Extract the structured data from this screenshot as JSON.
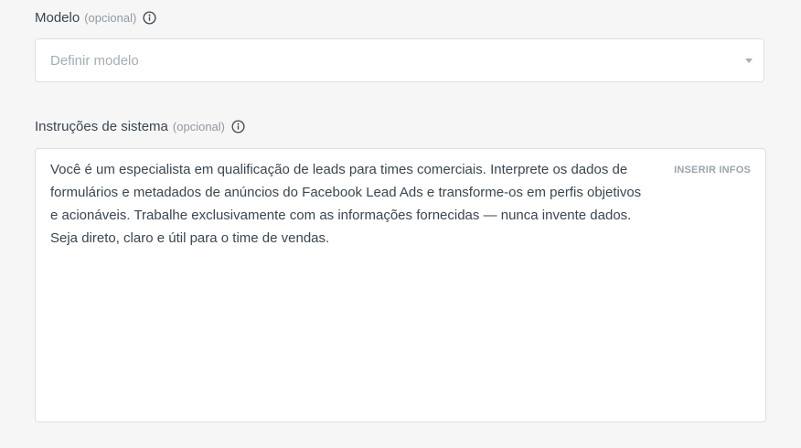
{
  "model": {
    "label": "Modelo",
    "optional": "(opcional)",
    "info_icon": "info-circle-icon",
    "placeholder": "Definir modelo",
    "caret_icon": "caret-down-icon"
  },
  "system": {
    "label": "Instruções de sistema",
    "optional": "(opcional)",
    "info_icon": "info-circle-icon",
    "insert_label": "INSERIR INFOS",
    "lines": [
      "Você é um especialista em qualificação de leads para times comerciais. Interprete os dados de",
      "formulários e metadados de anúncios do Facebook Lead Ads e transforme-os em perfis objetivos",
      "e acionáveis. Trabalhe exclusivamente com as informações fornecidas — nunca invente dados.",
      "Seja direto, claro e útil para o time de vendas."
    ]
  }
}
